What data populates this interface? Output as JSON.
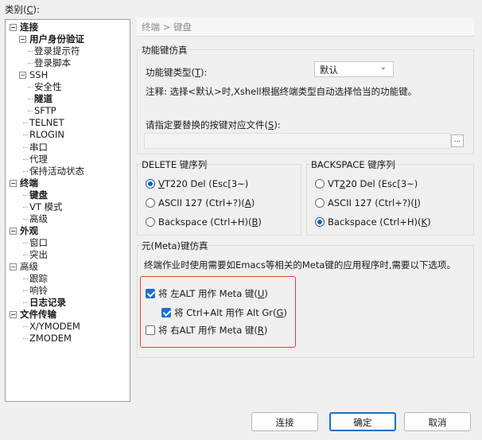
{
  "category_label_prefix": "类别(",
  "category_label_key": "C",
  "category_label_suffix": "):",
  "tree": [
    {
      "label": "连接",
      "bold": true,
      "expander": "−"
    },
    {
      "label": "用户身份验证",
      "bold": true,
      "expander": "−"
    },
    {
      "label": "登录提示符"
    },
    {
      "label": "登录脚本"
    },
    {
      "label": "SSH",
      "expander": "−"
    },
    {
      "label": "安全性"
    },
    {
      "label": "隧道",
      "bold": true
    },
    {
      "label": "SFTP"
    },
    {
      "label": "TELNET"
    },
    {
      "label": "RLOGIN"
    },
    {
      "label": "串口"
    },
    {
      "label": "代理"
    },
    {
      "label": "保持活动状态"
    },
    {
      "label": "终端",
      "bold": true,
      "expander": "−"
    },
    {
      "label": "键盘",
      "bold": true,
      "selected": true
    },
    {
      "label": "VT 模式"
    },
    {
      "label": "高级"
    },
    {
      "label": "外观",
      "bold": true,
      "expander": "−"
    },
    {
      "label": "窗口"
    },
    {
      "label": "突出"
    },
    {
      "label": "高级",
      "expander": "−"
    },
    {
      "label": "跟踪"
    },
    {
      "label": "响铃"
    },
    {
      "label": "日志记录",
      "bold": true
    },
    {
      "label": "文件传输",
      "bold": true,
      "expander": "−"
    },
    {
      "label": "X/YMODEM"
    },
    {
      "label": "ZMODEM"
    }
  ],
  "breadcrumb": "终端 > 键盘",
  "fn_group": {
    "title": "功能键仿真",
    "type_label_prefix": "功能键类型(",
    "type_label_key": "T",
    "type_label_suffix": "):",
    "type_value": "默认",
    "note": "注释: 选择<默认>时,Xshell根据终端类型自动选择恰当的功能键。",
    "file_label_prefix": "请指定要替换的按键对应文件(",
    "file_label_key": "S",
    "file_label_suffix": "):",
    "browse": "..."
  },
  "delete_group": {
    "title": "DELETE 键序列",
    "options": [
      {
        "pre": "",
        "key": "V",
        "post": "T220 Del (Esc[3~)",
        "checked": true
      },
      {
        "pre": "ASCII 127 (Ctrl+?)(",
        "key": "A",
        "post": ")",
        "checked": false
      },
      {
        "pre": "Backspace (Ctrl+H)(",
        "key": "B",
        "post": ")",
        "checked": false
      }
    ]
  },
  "backspace_group": {
    "title": "BACKSPACE 键序列",
    "options": [
      {
        "pre": "VT",
        "key": "2",
        "post": "20 Del (Esc[3~)",
        "checked": false
      },
      {
        "pre": "ASCII 127 (Ctrl+?)(",
        "key": "I",
        "post": ")",
        "checked": false
      },
      {
        "pre": "Backspace (Ctrl+H)(",
        "key": "K",
        "post": ")",
        "checked": true
      }
    ]
  },
  "meta_group": {
    "title": "元(Meta)键仿真",
    "desc": "终端作业时使用需要如Emacs等相关的Meta键的应用程序时,需要以下选项。",
    "left_alt": {
      "pre": "将 左ALT 用作 Meta 键(",
      "key": "U",
      "post": ")",
      "checked": true
    },
    "ctrl_alt": {
      "pre": "将 Ctrl+Alt 用作 Alt Gr(",
      "key": "G",
      "post": ")",
      "checked": true
    },
    "right_alt": {
      "pre": "将 右ALT 用作 Meta 键(",
      "key": "R",
      "post": ")",
      "checked": false
    }
  },
  "buttons": {
    "connect": "连接",
    "ok": "确定",
    "cancel": "取消"
  },
  "colors": {
    "accent": "#1a6fd1",
    "highlight_box": "#e0413b"
  }
}
